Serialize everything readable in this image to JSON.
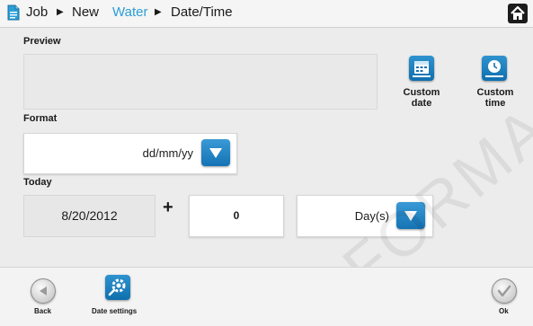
{
  "header": {
    "breadcrumb": [
      "Job",
      "New",
      "Water",
      "Date/Time"
    ],
    "active_crumb_color": "#2a9fd6"
  },
  "preview": {
    "label": "Preview",
    "value": ""
  },
  "custom_buttons": {
    "date_label_1": "Custom",
    "date_label_2": "date",
    "time_label_1": "Custom",
    "time_label_2": "time"
  },
  "format": {
    "label": "Format",
    "value": "dd/mm/yy"
  },
  "today": {
    "label": "Today",
    "date_value": "8/20/2012",
    "plus": "+",
    "offset_value": "0",
    "unit_value": "Day(s)"
  },
  "footer": {
    "back_label": "Back",
    "date_settings_label": "Date settings",
    "ok_label": "Ok"
  },
  "watermark": "FORMA",
  "colors": {
    "accent": "#1877b8",
    "tile": "#1e86c6"
  },
  "icons": [
    "document-icon",
    "home-icon",
    "calendar-icon",
    "clock-icon",
    "chevron-down-icon",
    "back-icon",
    "gear-icon",
    "ok-check-icon"
  ]
}
